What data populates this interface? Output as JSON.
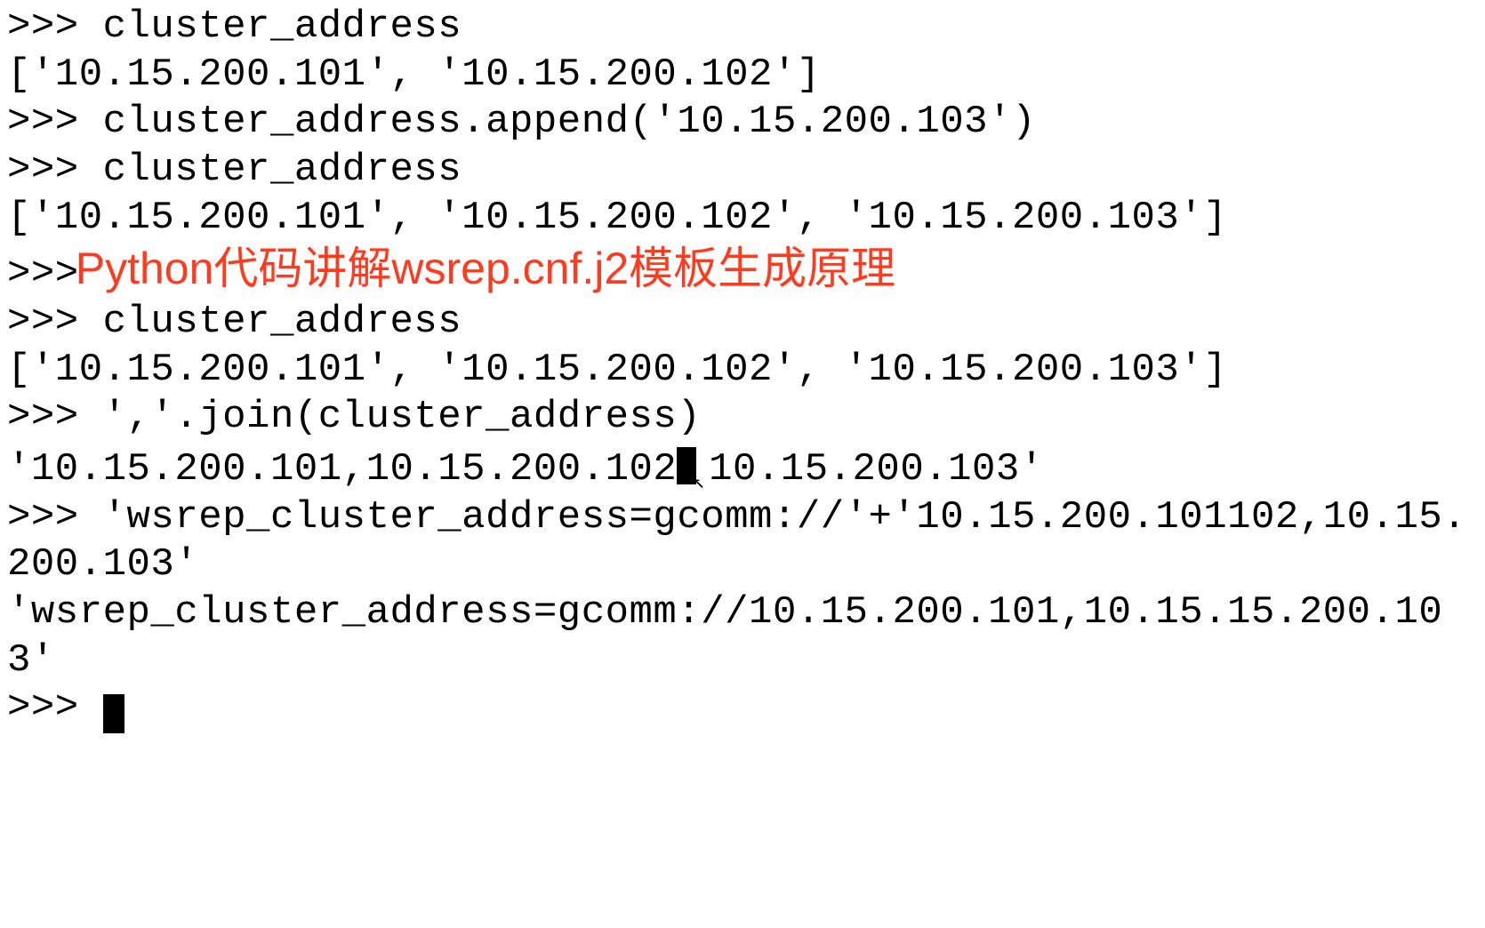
{
  "terminal": {
    "prompt": ">>> ",
    "lines": [
      ">>> cluster_address",
      "['10.15.200.101', '10.15.200.102']",
      ">>> cluster_address.append('10.15.200.103')",
      ">>> cluster_address",
      "['10.15.200.101', '10.15.200.102', '10.15.200.103']",
      ">>>",
      ">>> cluster_address",
      "['10.15.200.101', '10.15.200.102', '10.15.200.103']",
      ">>> ','.join(cluster_address)",
      "'10.15.200.101,10.15.200.102",
      "10.15.200.103'",
      ">>> 'wsrep_cluster_address=gcomm://'+'10.15.200.101102,10.15.200.103'",
      "'wsrep_cluster_address=gcomm://10.15.200.101,10.15.15.200.103'",
      ">>> "
    ]
  },
  "annotation": {
    "text": "Python代码讲解wsrep.cnf.j2模板生成原理",
    "color": "#ff3b1f"
  },
  "join_output": {
    "part1": "'10.15.200.101,10.15.200.102",
    "part2": "10.15.200.103'"
  },
  "wsrep_input": ">>> 'wsrep_cluster_address=gcomm://'+'10.15.200.101102,10.15.200.103'",
  "wsrep_output": "'wsrep_cluster_address=gcomm://10.15.200.101,10.15.15.200.103'",
  "final_prompt": ">>> "
}
